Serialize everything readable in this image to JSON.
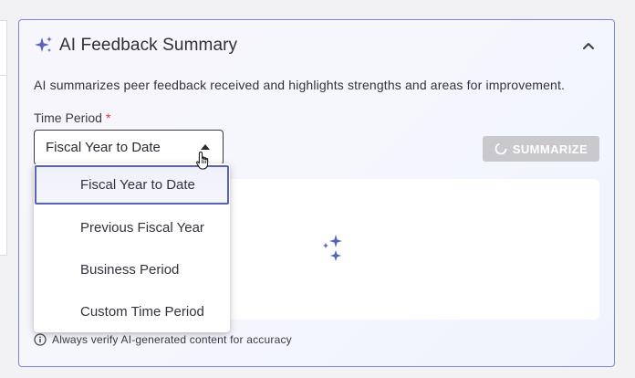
{
  "card": {
    "title": "AI Feedback Summary",
    "description": "AI summarizes peer feedback received and highlights strengths and areas for improvement.",
    "accent_color": "#5a62b8"
  },
  "form": {
    "time_period_label": "Time Period",
    "required_mark": "*",
    "selected_value": "Fiscal Year to Date"
  },
  "actions": {
    "summarize_label": "SUMMARIZE"
  },
  "dropdown": {
    "options": [
      "Fiscal Year to Date",
      "Previous Fiscal Year",
      "Business Period",
      "Custom Time Period"
    ]
  },
  "footer": {
    "disclaimer": "Always verify AI-generated content for accuracy"
  },
  "icons": {
    "header": "sparkle-icon",
    "collapse": "chevron-up-icon",
    "select_caret": "caret-up-icon",
    "button_loading": "spinner-icon",
    "result_placeholder": "sparkle-icon",
    "disclaimer": "info-icon",
    "pointer": "hand-cursor-icon"
  }
}
